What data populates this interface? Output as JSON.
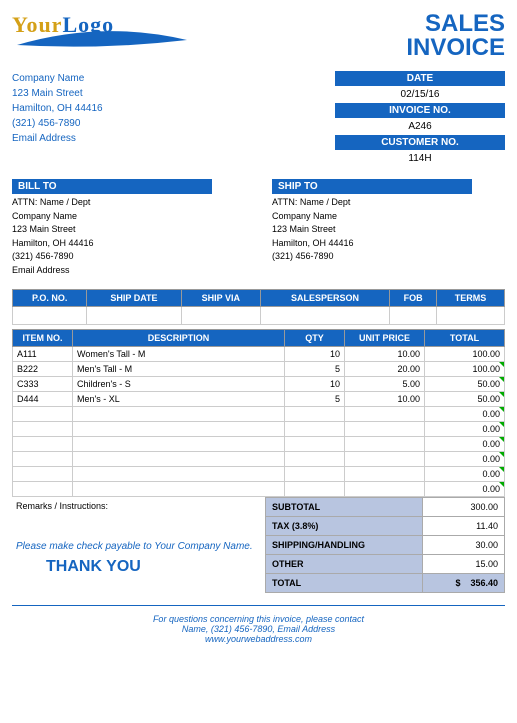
{
  "logo": {
    "your": "Your",
    "logo": "Logo"
  },
  "title": {
    "line1": "SALES",
    "line2": "INVOICE"
  },
  "company": {
    "name": "Company Name",
    "street": "123 Main Street",
    "citystate": "Hamilton, OH  44416",
    "phone": "(321) 456-7890",
    "email": "Email Address"
  },
  "meta": {
    "date_label": "DATE",
    "date_value": "02/15/16",
    "invno_label": "INVOICE NO.",
    "invno_value": "A246",
    "custno_label": "CUSTOMER NO.",
    "custno_value": "114H"
  },
  "billto": {
    "header": "BILL TO",
    "attn": "ATTN: Name / Dept",
    "name": "Company Name",
    "street": "123 Main Street",
    "citystate": "Hamilton, OH  44416",
    "phone": "(321) 456-7890",
    "email": "Email Address"
  },
  "shipto": {
    "header": "SHIP TO",
    "attn": "ATTN: Name / Dept",
    "name": "Company Name",
    "street": "123 Main Street",
    "citystate": "Hamilton, OH  44416",
    "phone": "(321) 456-7890"
  },
  "detail_headers": {
    "po": "P.O. NO.",
    "shipdate": "SHIP DATE",
    "shipvia": "SHIP VIA",
    "salesperson": "SALESPERSON",
    "fob": "FOB",
    "terms": "TERMS"
  },
  "item_headers": {
    "itemno": "ITEM NO.",
    "desc": "DESCRIPTION",
    "qty": "QTY",
    "unitprice": "UNIT PRICE",
    "total": "TOTAL"
  },
  "items": [
    {
      "no": "A111",
      "desc": "Women's Tall - M",
      "qty": "10",
      "price": "10.00",
      "total": "100.00"
    },
    {
      "no": "B222",
      "desc": "Men's Tall - M",
      "qty": "5",
      "price": "20.00",
      "total": "100.00"
    },
    {
      "no": "C333",
      "desc": "Children's - S",
      "qty": "10",
      "price": "5.00",
      "total": "50.00"
    },
    {
      "no": "D444",
      "desc": "Men's - XL",
      "qty": "5",
      "price": "10.00",
      "total": "50.00"
    }
  ],
  "empty_totals": [
    "0.00",
    "0.00",
    "0.00",
    "0.00",
    "0.00",
    "0.00"
  ],
  "remarks_label": "Remarks / Instructions:",
  "totals": {
    "subtotal_label": "SUBTOTAL",
    "subtotal": "300.00",
    "tax_label": "TAX (3.8%)",
    "tax": "11.40",
    "ship_label": "SHIPPING/HANDLING",
    "ship": "30.00",
    "other_label": "OTHER",
    "other": "15.00",
    "total_label": "TOTAL",
    "total_currency": "$",
    "total": "356.40"
  },
  "payable": "Please make check payable to Your Company Name.",
  "thanks": "THANK YOU",
  "footer": {
    "line1": "For questions concerning this invoice, please contact",
    "line2": "Name, (321) 456-7890, Email Address",
    "url": "www.yourwebaddress.com"
  }
}
